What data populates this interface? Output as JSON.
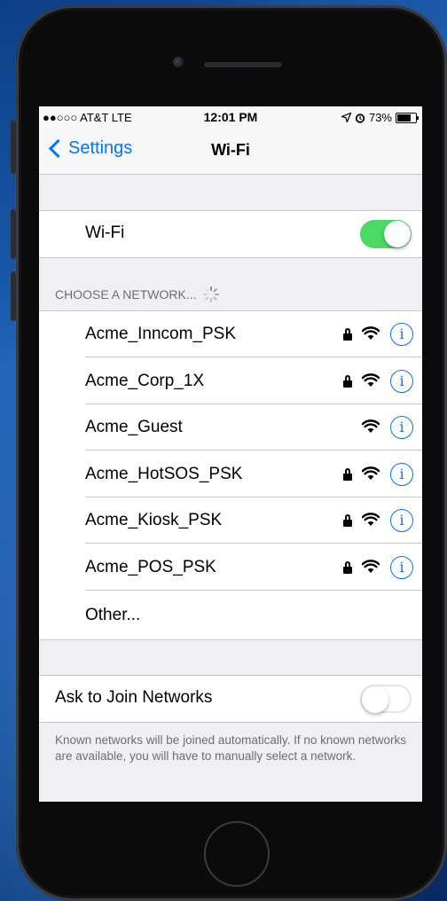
{
  "status_bar": {
    "carrier": "●●○○○ AT&T  LTE",
    "time": "12:01 PM",
    "battery": "73%",
    "location_icon": "location-arrow-icon",
    "alarm_icon": "alarm-icon"
  },
  "nav": {
    "back_label": "Settings",
    "title": "Wi-Fi"
  },
  "wifi_toggle": {
    "label": "Wi-Fi",
    "state": "on",
    "color": "#4cd964"
  },
  "section_header": "CHOOSE A NETWORK...",
  "networks": [
    {
      "name": "Acme_Inncom_PSK",
      "secured": true
    },
    {
      "name": "Acme_Corp_1X",
      "secured": true
    },
    {
      "name": "Acme_Guest",
      "secured": false
    },
    {
      "name": "Acme_HotSOS_PSK",
      "secured": true
    },
    {
      "name": "Acme_Kiosk_PSK",
      "secured": true
    },
    {
      "name": "Acme_POS_PSK",
      "secured": true
    }
  ],
  "other_label": "Other...",
  "ask_to_join": {
    "label": "Ask to Join Networks",
    "state": "off"
  },
  "footer": "Known networks will be joined automatically. If no known networks are available, you will have to manually select a network.",
  "accent_color": "#0076ff"
}
